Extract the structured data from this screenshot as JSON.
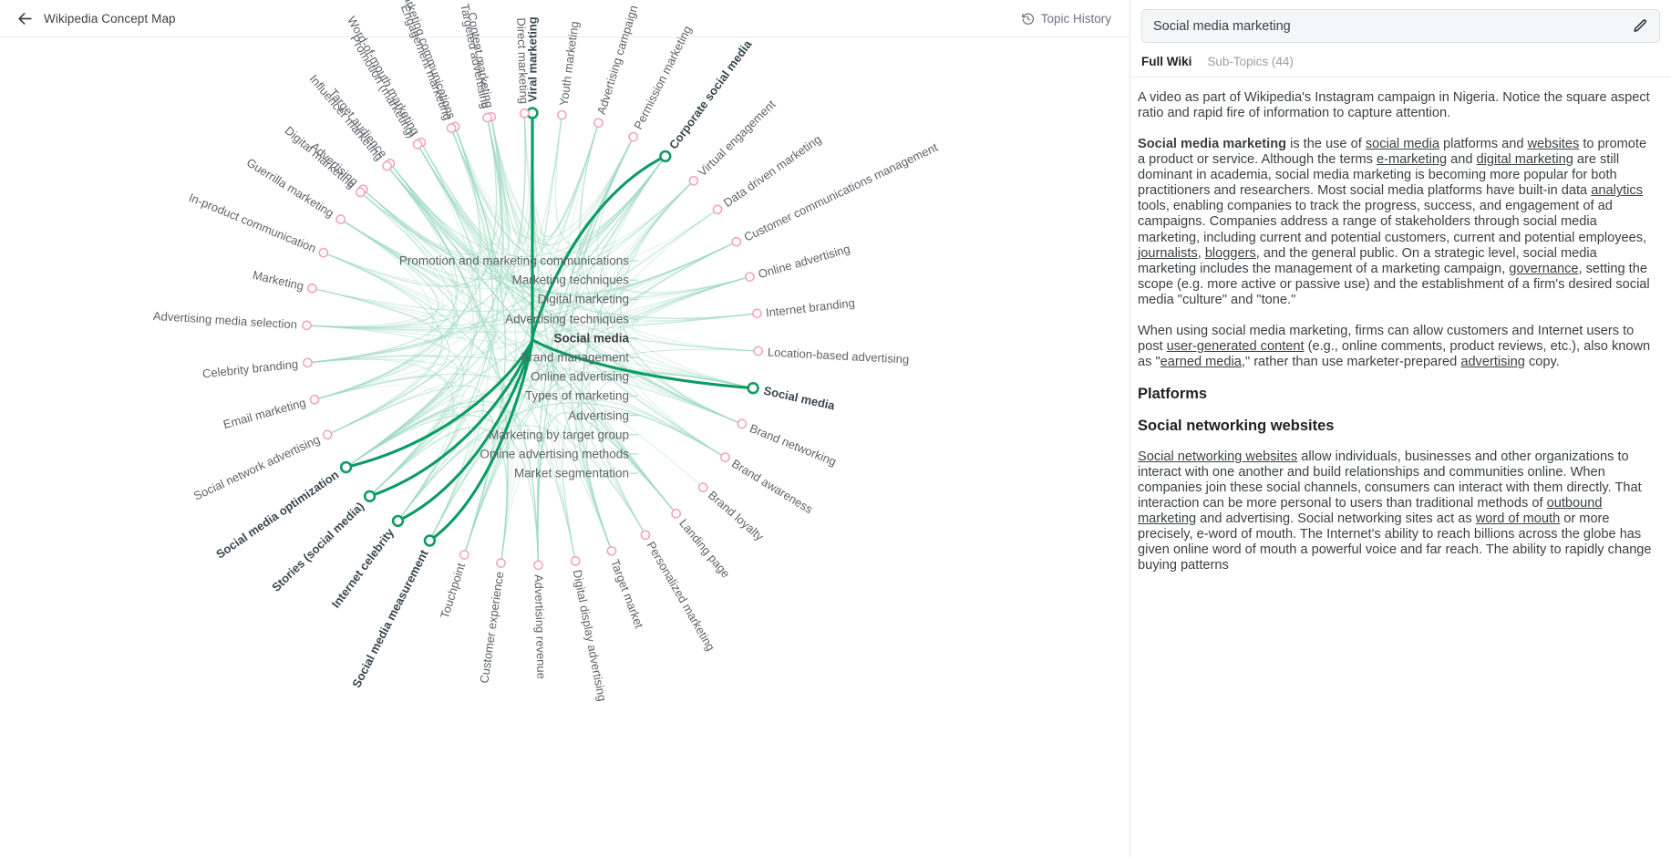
{
  "header": {
    "back_icon": "arrow-left-icon",
    "title": "Wikipedia Concept Map",
    "history_icon": "history-icon",
    "history_label": "Topic History"
  },
  "sidebar": {
    "topic_value": "Social media marketing",
    "edit_icon": "pencil-icon",
    "tabs": [
      {
        "label": "Full Wiki",
        "active": true
      },
      {
        "label": "Sub-Topics (44)",
        "active": false
      }
    ],
    "caption": "A video as part of Wikipedia's Instagram campaign in Nigeria. Notice the square aspect ratio and rapid fire of information to capture attention.",
    "para1": {
      "lead": "Social media marketing",
      "t1": " is the use of ",
      "l1": "social media",
      "t2": " platforms and ",
      "l2": "websites",
      "t3": " to promote a product or service. Although the terms ",
      "l3": "e-marketing",
      "t4": " and ",
      "l4": "digital marketing",
      "t5": " are still dominant in academia, social media marketing is becoming more popular for both practitioners and researchers. Most social media platforms have built-in data ",
      "l5": "analytics",
      "t6": " tools, enabling companies to track the progress, success, and engagement of ad campaigns. Companies address a range of stakeholders through social media marketing, including current and potential customers, current and potential employees, ",
      "l6": "journalists",
      "t7": ", ",
      "l7": "bloggers",
      "t8": ", and the general public. On a strategic level, social media marketing includes the management of a marketing campaign, ",
      "l8": "governance",
      "t9": ", setting the scope (e.g. more active or passive use) and the establishment of a firm's desired social media \"culture\" and \"tone.\""
    },
    "para2": {
      "t1": "When using social media marketing, firms can allow customers and Internet users to post ",
      "l1": "user-generated content",
      "t2": " (e.g., online comments, product reviews, etc.), also known as \"",
      "l2": "earned media",
      "t3": ",\" rather than use marketer-prepared ",
      "l3": "advertising",
      "t4": " copy."
    },
    "h_platforms": "Platforms",
    "h_social_networking": "Social networking websites",
    "para3": {
      "l1": "Social networking websites",
      "t1": " allow individuals, businesses and other organizations to interact with one another and build relationships and communities online. When companies join these social channels, consumers can interact with them directly. That interaction can be more personal to users than traditional methods of ",
      "l2": "outbound marketing",
      "t2": " and advertising. Social networking sites act as ",
      "l3": "word of mouth",
      "t3": " or more precisely, e-word of mouth. The Internet's ability to reach billions across the globe has given online word of mouth a powerful voice and far reach. The ability to rapidly change buying patterns"
    }
  },
  "map": {
    "center_items": [
      {
        "label": "Promotion and marketing communications",
        "selected": false
      },
      {
        "label": "Marketing techniques",
        "selected": false
      },
      {
        "label": "Digital marketing",
        "selected": false
      },
      {
        "label": "Advertising techniques",
        "selected": false
      },
      {
        "label": "Social media",
        "selected": true
      },
      {
        "label": "Brand management",
        "selected": false
      },
      {
        "label": "Online advertising",
        "selected": false
      },
      {
        "label": "Types of marketing",
        "selected": false
      },
      {
        "label": "Advertising",
        "selected": false
      },
      {
        "label": "Marketing by target group",
        "selected": false
      },
      {
        "label": "Online advertising methods",
        "selected": false
      },
      {
        "label": "Market segmentation",
        "selected": false
      }
    ],
    "colors": {
      "node_default": "#f4a0bd",
      "node_highlight": "#109b62",
      "link_default": "#9ed9c2",
      "link_highlight": "#0d9b63",
      "label_default": "#5f6368",
      "label_highlight": "#37474f"
    },
    "nodes": [
      {
        "label": "Viral marketing",
        "angle": -90,
        "highlight": true
      },
      {
        "label": "Content marketing",
        "angle": -100.5,
        "highlight": false
      },
      {
        "label": "Marketing communications",
        "angle": -110,
        "highlight": false
      },
      {
        "label": "Word-of-mouth marketing",
        "angle": -119.5,
        "highlight": false
      },
      {
        "label": "Target audience",
        "angle": -129,
        "highlight": false
      },
      {
        "label": "Advertising",
        "angle": -138.5,
        "highlight": false
      },
      {
        "label": "Guerrilla marketing",
        "angle": -148,
        "highlight": false
      },
      {
        "label": "In-product communication",
        "angle": -157.5,
        "highlight": false
      },
      {
        "label": "Marketing",
        "angle": -167,
        "highlight": false
      },
      {
        "label": "Advertising media selection",
        "angle": -176.5,
        "highlight": false
      },
      {
        "label": "Celebrity branding",
        "angle": 174,
        "highlight": false
      },
      {
        "label": "Email marketing",
        "angle": 164.5,
        "highlight": false
      },
      {
        "label": "Social network advertising",
        "angle": 155,
        "highlight": false
      },
      {
        "label": "Social media optimization",
        "angle": 145.5,
        "highlight": true
      },
      {
        "label": "Stories (social media)",
        "angle": 136,
        "highlight": true
      },
      {
        "label": "Internet celebrity",
        "angle": 126.5,
        "highlight": true
      },
      {
        "label": "Social media measurement",
        "angle": 117,
        "highlight": true
      },
      {
        "label": "Touchpoint",
        "angle": 107.5,
        "highlight": false
      },
      {
        "label": "Customer experience",
        "angle": 98,
        "highlight": false
      },
      {
        "label": "Advertising revenue",
        "angle": 88.5,
        "highlight": false
      },
      {
        "label": "Digital display advertising",
        "angle": 79,
        "highlight": false
      },
      {
        "label": "Target market",
        "angle": 69.5,
        "highlight": false
      },
      {
        "label": "Personalized marketing",
        "angle": 60,
        "highlight": false
      },
      {
        "label": "Landing page",
        "angle": 50.5,
        "highlight": false
      },
      {
        "label": "Brand loyalty",
        "angle": 41,
        "highlight": false
      },
      {
        "label": "Brand awareness",
        "angle": 31.5,
        "highlight": false
      },
      {
        "label": "Brand networking",
        "angle": 22,
        "highlight": false
      },
      {
        "label": "Social media",
        "angle": 12.5,
        "highlight": true
      },
      {
        "label": "Location-based advertising",
        "angle": 3,
        "highlight": false
      },
      {
        "label": "Internet branding",
        "angle": -6.5,
        "highlight": false
      },
      {
        "label": "Online advertising",
        "angle": -16,
        "highlight": false
      },
      {
        "label": "Customer communications management",
        "angle": -25.5,
        "highlight": false
      },
      {
        "label": "Data driven marketing",
        "angle": -35,
        "highlight": false
      },
      {
        "label": "Virtual engagement",
        "angle": -44.5,
        "highlight": false
      },
      {
        "label": "Corporate social media",
        "angle": -54,
        "highlight": true
      },
      {
        "label": "Permission marketing",
        "angle": -63.5,
        "highlight": false
      },
      {
        "label": "Advertising campaign",
        "angle": -73,
        "highlight": false
      },
      {
        "label": "Youth marketing",
        "angle": -82.5,
        "highlight": false
      },
      {
        "label": "Direct marketing",
        "angle": -92,
        "highlight": false
      },
      {
        "label": "Targeted advertising",
        "angle": -101.5,
        "highlight": false
      },
      {
        "label": "Engagement marketing",
        "angle": -111,
        "highlight": false
      },
      {
        "label": "Promotion (marketing)",
        "angle": -120.5,
        "highlight": false
      },
      {
        "label": "Influencer marketing",
        "angle": -130,
        "highlight": false
      },
      {
        "label": "Digital marketing",
        "angle": -139.5,
        "highlight": false
      }
    ]
  }
}
